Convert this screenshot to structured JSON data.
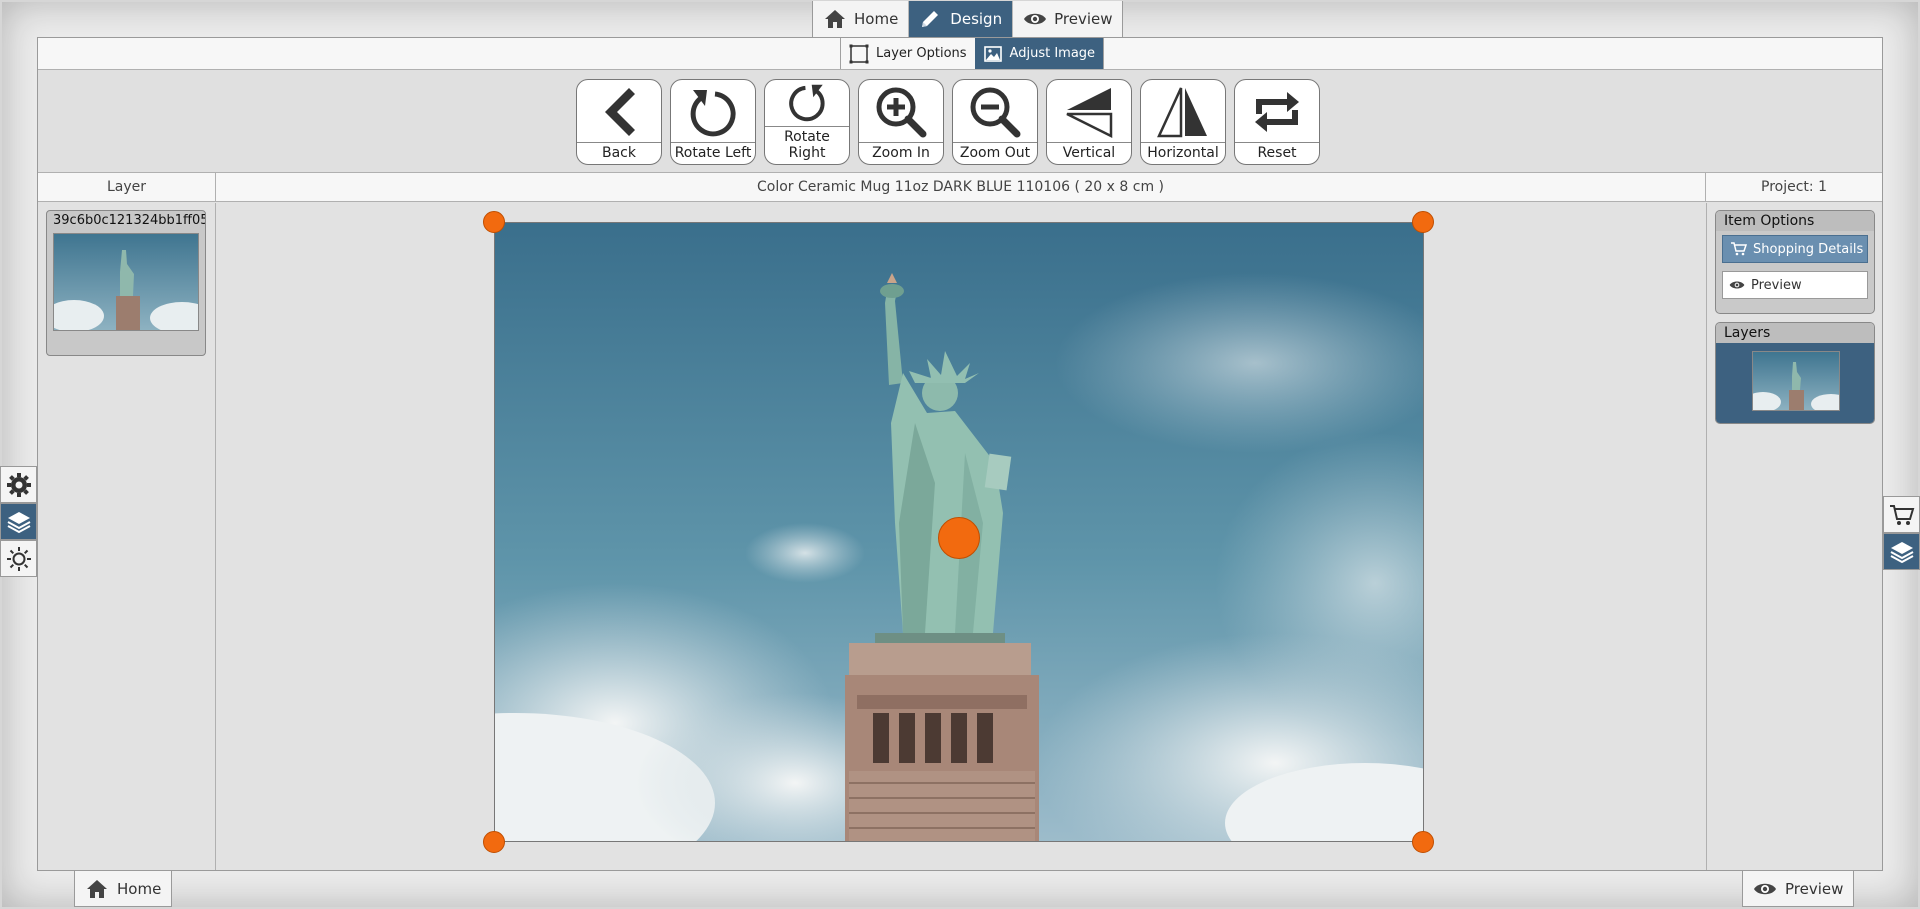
{
  "top_tabs": [
    {
      "label": "Home",
      "icon": "home-icon"
    },
    {
      "label": "Design",
      "icon": "pencil-icon",
      "active": true
    },
    {
      "label": "Preview",
      "icon": "eye-icon"
    }
  ],
  "sub_tabs": [
    {
      "label": "Layer Options",
      "icon": "layer-options-icon"
    },
    {
      "label": "Adjust Image",
      "icon": "adjust-image-icon",
      "active": true
    }
  ],
  "tools": [
    {
      "label": "Back",
      "icon": "chevron-left-icon"
    },
    {
      "label": "Rotate Left",
      "icon": "rotate-left-icon"
    },
    {
      "label": "Rotate Right",
      "icon": "rotate-right-icon"
    },
    {
      "label": "Zoom In",
      "icon": "zoom-in-icon"
    },
    {
      "label": "Zoom Out",
      "icon": "zoom-out-icon"
    },
    {
      "label": "Vertical",
      "icon": "flip-vertical-icon"
    },
    {
      "label": "Horizontal",
      "icon": "flip-horizontal-icon"
    },
    {
      "label": "Reset",
      "icon": "reset-icon"
    }
  ],
  "header": {
    "layer": "Layer",
    "product": "Color Ceramic Mug 11oz DARK BLUE 110106 ( 20 x 8 cm )",
    "project": "Project: 1"
  },
  "layer_panel": {
    "name": "39c6b0c121324bb1ff05..."
  },
  "item_options": {
    "title": "Item Options",
    "shopping": "Shopping Details",
    "preview": "Preview"
  },
  "layers_panel": {
    "title": "Layers"
  },
  "bottom": {
    "home": "Home",
    "preview": "Preview"
  },
  "colors": {
    "accent": "#3d6180",
    "handle": "#f26a0f"
  }
}
